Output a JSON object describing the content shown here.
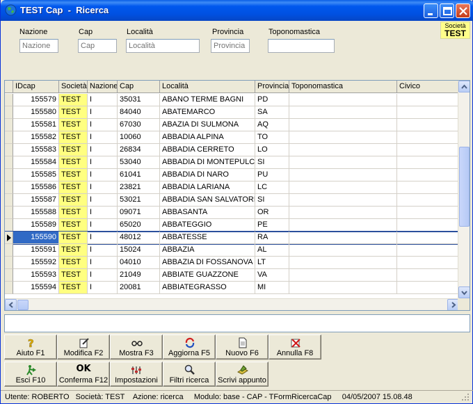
{
  "window": {
    "title": "TEST Cap  -  Ricerca"
  },
  "societa_badge": {
    "label": "Società",
    "value": "TEST"
  },
  "filters": [
    {
      "label": "Nazione",
      "placeholder": "Nazione",
      "value": ""
    },
    {
      "label": "Cap",
      "placeholder": "Cap",
      "value": ""
    },
    {
      "label": "Località",
      "placeholder": "Località",
      "value": ""
    },
    {
      "label": "Provincia",
      "placeholder": "Provincia",
      "value": ""
    },
    {
      "label": "Toponomastica",
      "placeholder": "",
      "value": ""
    }
  ],
  "grid": {
    "columns": [
      "IDcap",
      "Società",
      "Nazione",
      "Cap",
      "Località",
      "Provincia",
      "Toponomastica",
      "Civico"
    ],
    "selected_row": 11,
    "rows": [
      [
        "155579",
        "TEST",
        "I",
        "35031",
        "ABANO TERME BAGNI",
        "PD"
      ],
      [
        "155580",
        "TEST",
        "I",
        "84040",
        "ABATEMARCO",
        "SA"
      ],
      [
        "155581",
        "TEST",
        "I",
        "67030",
        "ABAZIA DI SULMONA",
        "AQ"
      ],
      [
        "155582",
        "TEST",
        "I",
        "10060",
        "ABBADIA ALPINA",
        "TO"
      ],
      [
        "155583",
        "TEST",
        "I",
        "26834",
        "ABBADIA CERRETO",
        "LO"
      ],
      [
        "155584",
        "TEST",
        "I",
        "53040",
        "ABBADIA DI MONTEPULCIANO",
        "SI"
      ],
      [
        "155585",
        "TEST",
        "I",
        "61041",
        "ABBADIA DI NARO",
        "PU"
      ],
      [
        "155586",
        "TEST",
        "I",
        "23821",
        "ABBADIA LARIANA",
        "LC"
      ],
      [
        "155587",
        "TEST",
        "I",
        "53021",
        "ABBADIA SAN SALVATORE",
        "SI"
      ],
      [
        "155588",
        "TEST",
        "I",
        "09071",
        "ABBASANTA",
        "OR"
      ],
      [
        "155589",
        "TEST",
        "I",
        "65020",
        "ABBATEGGIO",
        "PE"
      ],
      [
        "155590",
        "TEST",
        "I",
        "48012",
        "ABBATESSE",
        "RA"
      ],
      [
        "155591",
        "TEST",
        "I",
        "15024",
        "ABBAZIA",
        "AL"
      ],
      [
        "155592",
        "TEST",
        "I",
        "04010",
        "ABBAZIA DI FOSSANOVA",
        "LT"
      ],
      [
        "155593",
        "TEST",
        "I",
        "21049",
        "ABBIATE GUAZZONE",
        "VA"
      ],
      [
        "155594",
        "TEST",
        "I",
        "20081",
        "ABBIATEGRASSO",
        "MI"
      ]
    ]
  },
  "toolbar_row1": [
    {
      "name": "aiuto-button",
      "icon": "help-icon",
      "label": "Aiuto  F1"
    },
    {
      "name": "modifica-button",
      "icon": "edit-icon",
      "label": "Modifica  F2"
    },
    {
      "name": "mostra-button",
      "icon": "glasses-icon",
      "label": "Mostra F3"
    },
    {
      "name": "aggiorna-button",
      "icon": "refresh-icon",
      "label": "Aggiorna  F5"
    },
    {
      "name": "nuovo-button",
      "icon": "new-document-icon",
      "label": "Nuovo  F6"
    },
    {
      "name": "annulla-button",
      "icon": "cancel-icon",
      "label": "Annulla  F8"
    }
  ],
  "toolbar_row2": [
    {
      "name": "esci-button",
      "icon": "exit-icon",
      "label": "Esci  F10"
    },
    {
      "name": "conferma-button",
      "icon": "ok-icon",
      "label": "Conferma  F12",
      "icon_text": "OK"
    },
    {
      "name": "impostazioni-button",
      "icon": "settings-icon",
      "label": "Impostazioni"
    },
    {
      "name": "filtri-button",
      "icon": "filter-search-icon",
      "label": "Filtri ricerca"
    },
    {
      "name": "scrivi-appunto-button",
      "icon": "note-icon",
      "label": "Scrivi appunto"
    }
  ],
  "status_bar": {
    "text": "Utente: ROBERTO   Società: TEST    Azione: ricerca     Modulo: base - CAP - TFormRicercaCap     04/05/2007 15.08.48"
  },
  "colors": {
    "titlebar": "#0058ee",
    "societa_highlight": "#ffff80",
    "selection": "#316ac5"
  }
}
